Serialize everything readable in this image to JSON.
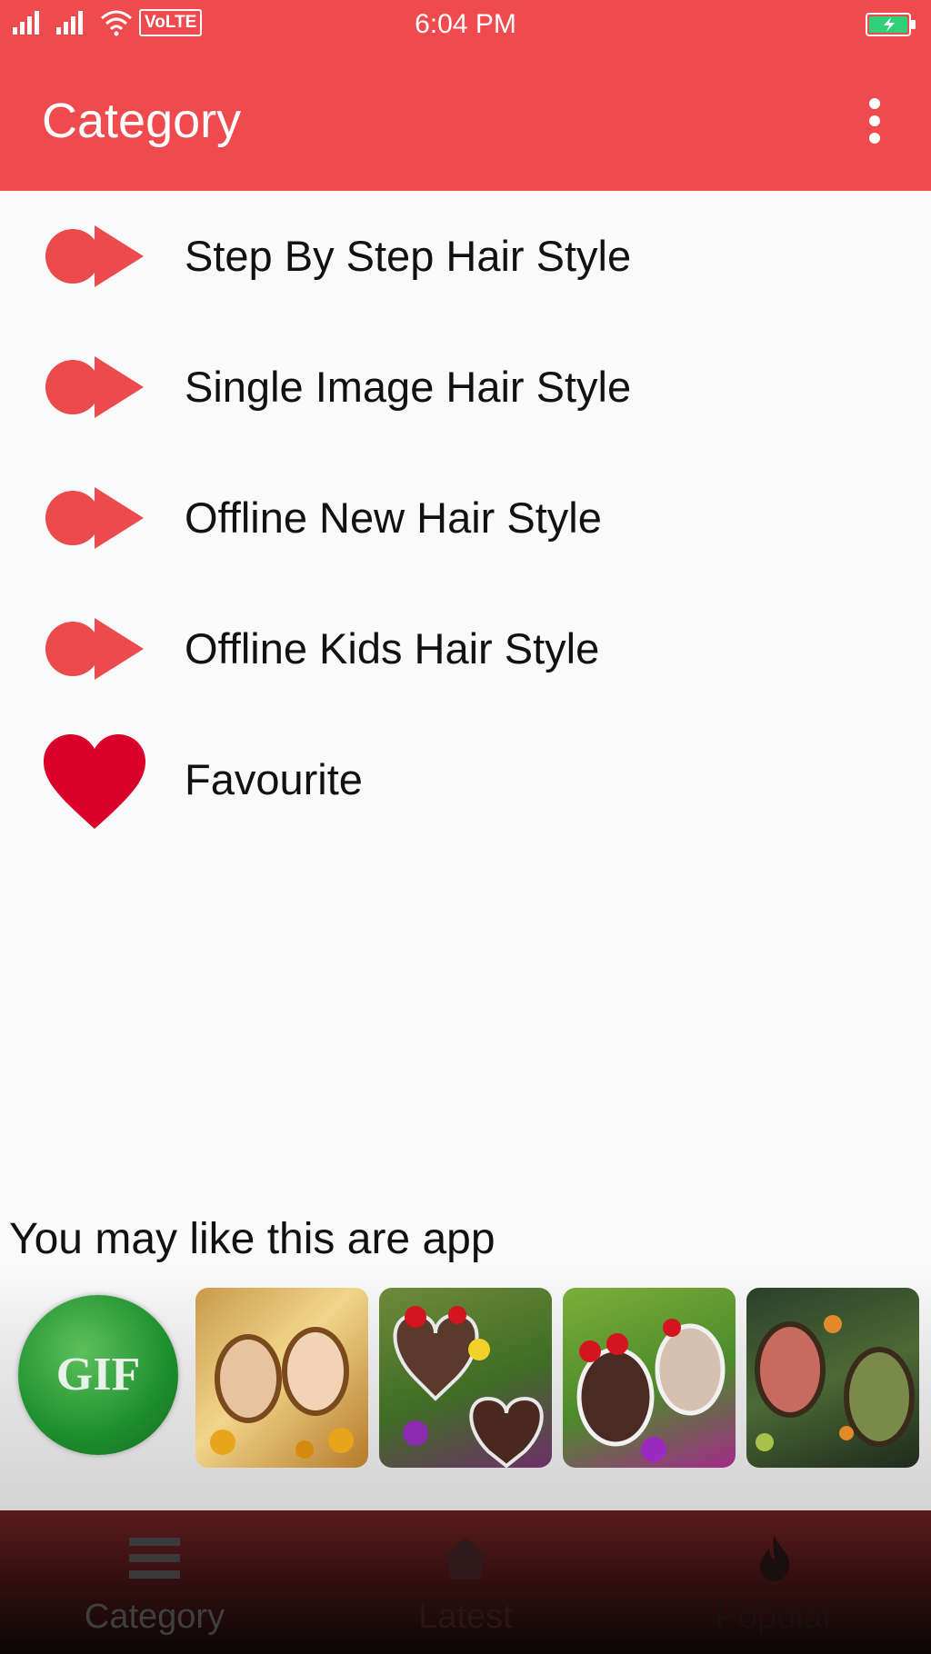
{
  "status_bar": {
    "time": "6:04 PM",
    "network_badge": "VoLTE"
  },
  "app_bar": {
    "title": "Category",
    "menu_icon": "more-vert-icon"
  },
  "categories": [
    {
      "label": "Step By Step Hair Style",
      "icon": "record-play-icon"
    },
    {
      "label": "Single Image Hair Style",
      "icon": "record-play-icon"
    },
    {
      "label": "Offline New Hair Style",
      "icon": "record-play-icon"
    },
    {
      "label": "Offline Kids Hair Style",
      "icon": "record-play-icon"
    },
    {
      "label": "Favourite",
      "icon": "heart-icon"
    }
  ],
  "recommend": {
    "title": "You may like this are app",
    "gif_app_text": "GIF"
  },
  "bottom_nav": [
    {
      "label": "Category",
      "icon": "menu-icon"
    },
    {
      "label": "Latest",
      "icon": "home-icon"
    },
    {
      "label": "Popular",
      "icon": "flame-icon"
    }
  ],
  "colors": {
    "primary": "#ef4a4d",
    "icon_red": "#ec4b4e",
    "heart": "#d9002a"
  }
}
